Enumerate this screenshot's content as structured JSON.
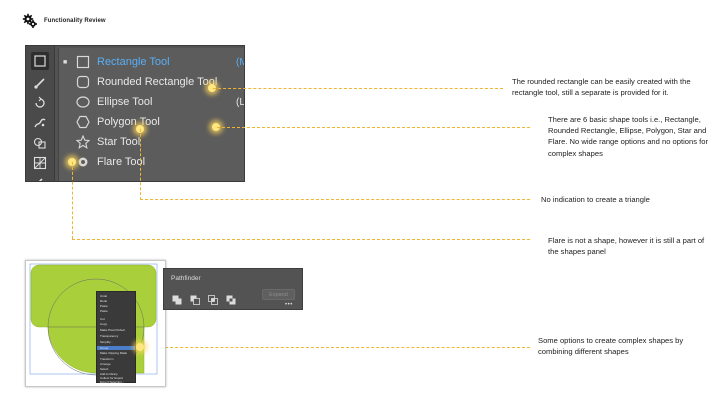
{
  "header": {
    "title": "Functionality Review",
    "icon": "gears-icon"
  },
  "flyout": {
    "items": [
      {
        "label": "Rectangle Tool",
        "shortcut": "(M)",
        "icon": "rectangle-icon",
        "active": true,
        "mark": "■"
      },
      {
        "label": "Rounded Rectangle Tool",
        "shortcut": "",
        "icon": "rounded-rectangle-icon",
        "active": false,
        "mark": ""
      },
      {
        "label": "Ellipse Tool",
        "shortcut": "(L)",
        "icon": "ellipse-icon",
        "active": false,
        "mark": ""
      },
      {
        "label": "Polygon Tool",
        "shortcut": "",
        "icon": "polygon-icon",
        "active": false,
        "mark": ""
      },
      {
        "label": "Star Tool",
        "shortcut": "",
        "icon": "star-icon",
        "active": false,
        "mark": ""
      },
      {
        "label": "Flare Tool",
        "shortcut": "",
        "icon": "flare-icon",
        "active": false,
        "mark": ""
      }
    ],
    "active_color": "#5aaef5"
  },
  "notes": {
    "rounded": "The rounded rectangle can be easily created with the rectangle tool, still a separate is provided for it.",
    "basic_shapes": "There are 6 basic shape tools i.e., Rectangle, Rounded Rectangle, Ellipse, Polygon, Star and Flare. No wide range options and no options for complex shapes",
    "triangle": "No indication to create a triangle",
    "flare": "Flare is not a shape, however it is still a part of the shapes panel",
    "complex": "Some options to create complex shapes by combining different shapes"
  },
  "pathfinder": {
    "title": "Pathfinder",
    "expand_label": "Expand",
    "more": "•••"
  },
  "context_menu": {
    "items": [
      "Undo",
      "Redo",
      "Paste",
      "Paste",
      "",
      "Cut",
      "Copy",
      "Make Pixel Perfect",
      "Transparency",
      "Simplify...",
      "Group",
      "Make Clipping Mask",
      "Transform",
      "Arrange",
      "Select",
      "Add to library",
      "Collect for Export",
      "Export Selection..."
    ],
    "highlighted_index": 10
  },
  "colors": {
    "accent": "#f2b531",
    "shape_fill": "#a9cf3a",
    "panel": "#535353"
  }
}
